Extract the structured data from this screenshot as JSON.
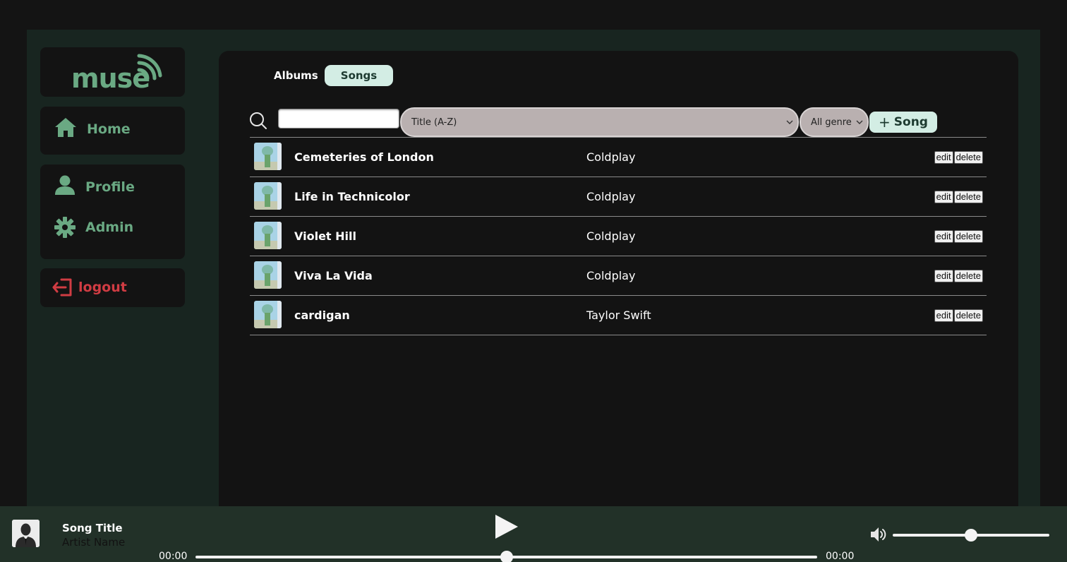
{
  "app": {
    "logo_text": "muse",
    "brand_color": "#6aa983",
    "danger_color": "#d03c43"
  },
  "sidebar": {
    "home_label": "Home",
    "profile_label": "Profile",
    "admin_label": "Admin",
    "logout_label": "logout"
  },
  "tabs": {
    "albums_label": "Albums",
    "songs_label": "Songs",
    "active": "Songs"
  },
  "toolbar": {
    "search_value": "",
    "sort_value": "Title (A-Z)",
    "genre_value": "All genre",
    "add_label": "Song",
    "add_icon": "+"
  },
  "songs": [
    {
      "title": "Cemeteries of London",
      "artist": "Coldplay",
      "edit_label": "edit",
      "delete_label": "delete"
    },
    {
      "title": "Life in Technicolor",
      "artist": "Coldplay",
      "edit_label": "edit",
      "delete_label": "delete"
    },
    {
      "title": "Violet Hill",
      "artist": "Coldplay",
      "edit_label": "edit",
      "delete_label": "delete"
    },
    {
      "title": "Viva La Vida",
      "artist": "Coldplay",
      "edit_label": "edit",
      "delete_label": "delete"
    },
    {
      "title": "cardigan",
      "artist": "Taylor Swift",
      "edit_label": "edit",
      "delete_label": "delete"
    }
  ],
  "player": {
    "title": "Song Title",
    "artist": "Artist Name",
    "time_current": "00:00",
    "time_total": "00:00",
    "progress_percent": 50,
    "volume_percent": 50
  }
}
